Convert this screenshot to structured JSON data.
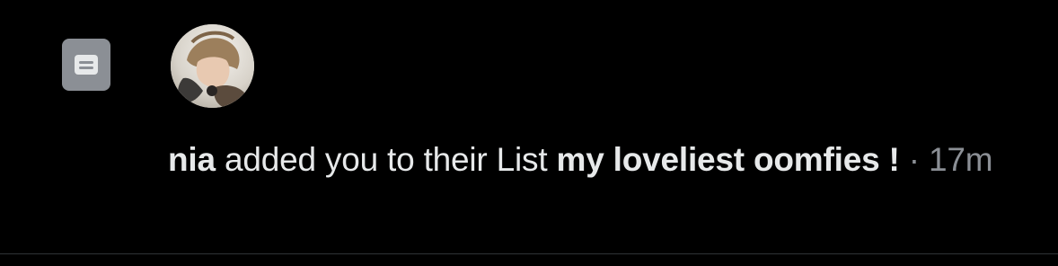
{
  "notification": {
    "icon": "list-icon",
    "avatar": "user-avatar",
    "user_name": "nia",
    "action_text": " added you to their List ",
    "list_name": "my loveliest oomfies !",
    "separator": " · ",
    "time": "17m"
  },
  "colors": {
    "background": "#000000",
    "text": "#e7e9ea",
    "secondary_text": "#8b8f95",
    "icon_background": "#8b8f95",
    "divider": "#2f3336"
  }
}
